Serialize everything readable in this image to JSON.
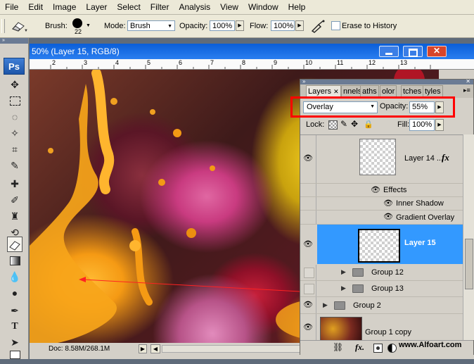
{
  "menu": [
    "File",
    "Edit",
    "Image",
    "Layer",
    "Select",
    "Filter",
    "Analysis",
    "View",
    "Window",
    "Help"
  ],
  "options": {
    "brush_label": "Brush:",
    "brush_size": "22",
    "mode_label": "Mode:",
    "mode_value": "Brush",
    "opacity_label": "Opacity:",
    "opacity_value": "100%",
    "flow_label": "Flow:",
    "flow_value": "100%",
    "erase_history_label": "Erase to History"
  },
  "document": {
    "title": "50% (Layer 15, RGB/8)",
    "ruler_ticks": [
      "2",
      "3",
      "4",
      "5",
      "6",
      "7",
      "8",
      "9",
      "10",
      "11",
      "12",
      "13"
    ],
    "status": "Doc: 8.58M/268.1M"
  },
  "toolbox": {
    "logo": "Ps"
  },
  "layers_panel": {
    "tabs": [
      "Layers",
      "nnels",
      "aths",
      "olor",
      "tches",
      "tyles"
    ],
    "blend_mode": "Overlay",
    "opacity_label": "Opacity:",
    "opacity_value": "55%",
    "lock_label": "Lock:",
    "fill_label": "Fill:",
    "fill_value": "100%",
    "layers": {
      "layer14": "Layer 14 ...",
      "effects": "Effects",
      "inner_shadow": "Inner Shadow",
      "gradient_overlay": "Gradient Overlay",
      "layer15": "Layer 15",
      "group12": "Group 12",
      "group13": "Group 13",
      "group2": "Group 2",
      "group1copy": "Group 1 copy"
    },
    "fx_badge": "fx",
    "bottom_fx": "fx."
  },
  "watermark": "www.Alfoart.com",
  "colors": {
    "highlight": "#3399ff",
    "annotation": "#ff0000",
    "title_bar": "#0a5ed8"
  }
}
